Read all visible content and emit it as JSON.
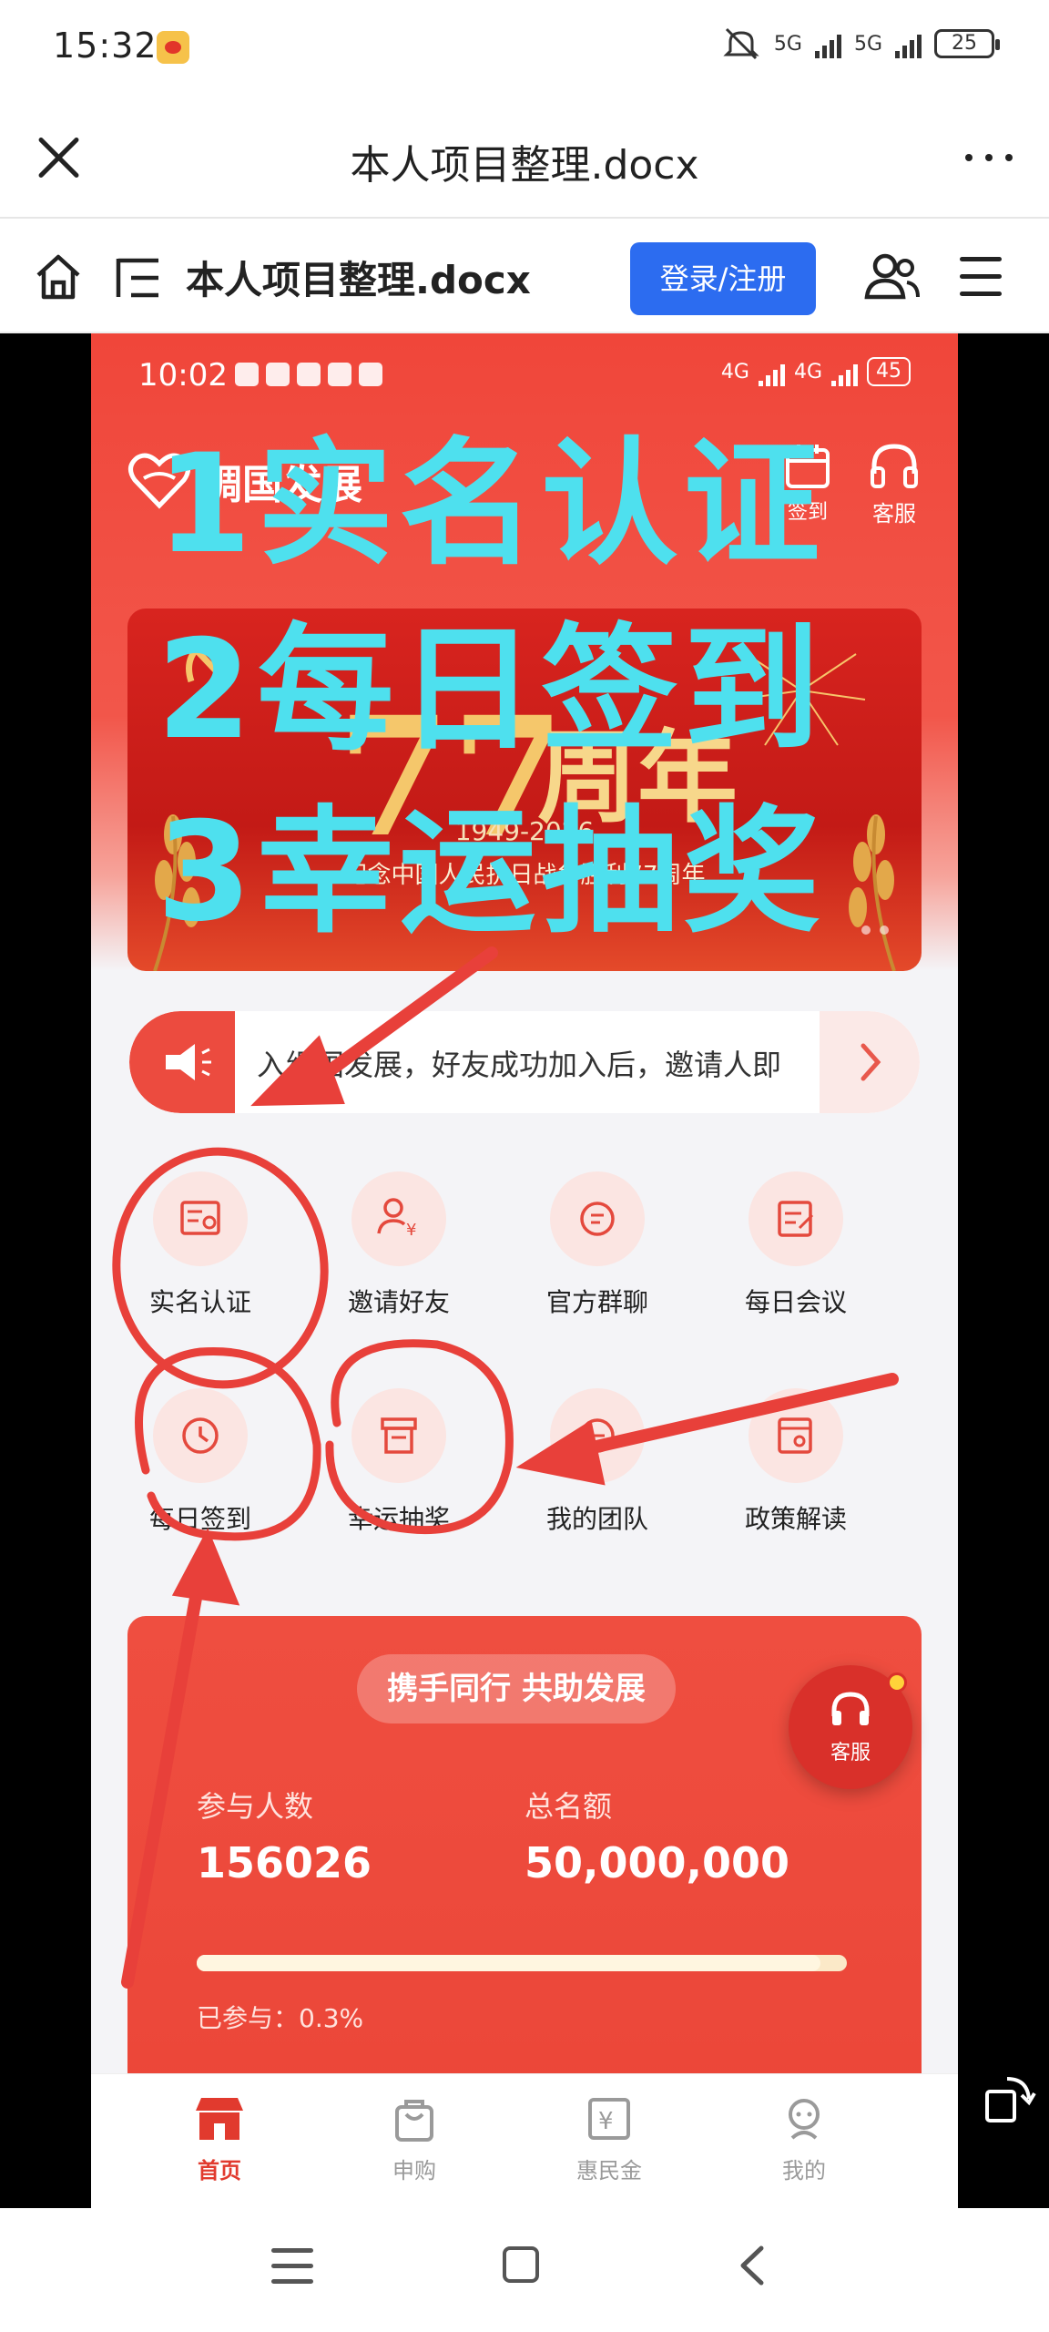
{
  "status_bar": {
    "time": "15:32",
    "net1": "5G",
    "net2": "5G",
    "battery": "25"
  },
  "browser": {
    "title": "本人项目整理.docx",
    "more_label": "···"
  },
  "doc_bar": {
    "title": "本人项目整理.docx",
    "login_label": "登录/注册"
  },
  "screenshot": {
    "status": {
      "time": "10:02",
      "net1": "4G",
      "net2": "4G",
      "battery": "45"
    },
    "brand": "绸国发展",
    "top_icons": {
      "sign": "签到",
      "service": "客服"
    },
    "banner": {
      "big_number": "77",
      "big_text": "周年",
      "years": "1949-2026",
      "subtitle": "纪念中国人民抗日战争胜利77周年"
    },
    "notice": "入绸国发展，好友成功加入后，邀请人即",
    "grid": [
      {
        "label": "实名认证",
        "icon": "id-card-icon"
      },
      {
        "label": "邀请好友",
        "icon": "invite-user-icon"
      },
      {
        "label": "官方群聊",
        "icon": "chat-icon"
      },
      {
        "label": "每日会议",
        "icon": "meeting-icon"
      },
      {
        "label": "每日签到",
        "icon": "clock-icon"
      },
      {
        "label": "幸运抽奖",
        "icon": "lottery-icon"
      },
      {
        "label": "我的团队",
        "icon": "team-icon"
      },
      {
        "label": "政策解读",
        "icon": "policy-icon"
      }
    ],
    "card": {
      "title": "携手同行 共助发展",
      "participants_label": "参与人数",
      "participants": "156026",
      "quota_label": "总名额",
      "quota": "50,000,000",
      "joined": "已参与：0.3%",
      "progress": 0.96
    },
    "float_service": "客服",
    "tabs": [
      {
        "label": "首页",
        "icon": "store-icon",
        "active": true
      },
      {
        "label": "申购",
        "icon": "bag-icon",
        "active": false
      },
      {
        "label": "惠民金",
        "icon": "yen-icon",
        "active": false
      },
      {
        "label": "我的",
        "icon": "profile-icon",
        "active": false
      }
    ]
  },
  "annotations": {
    "line1": "1实名认证",
    "line2": "2每日签到",
    "line3": "3幸运抽奖",
    "color_text": "#4ee0ee",
    "color_marks": "#e8403a"
  },
  "colors": {
    "brand_red": "#ef4e40",
    "login_blue": "#2c6cf0"
  }
}
